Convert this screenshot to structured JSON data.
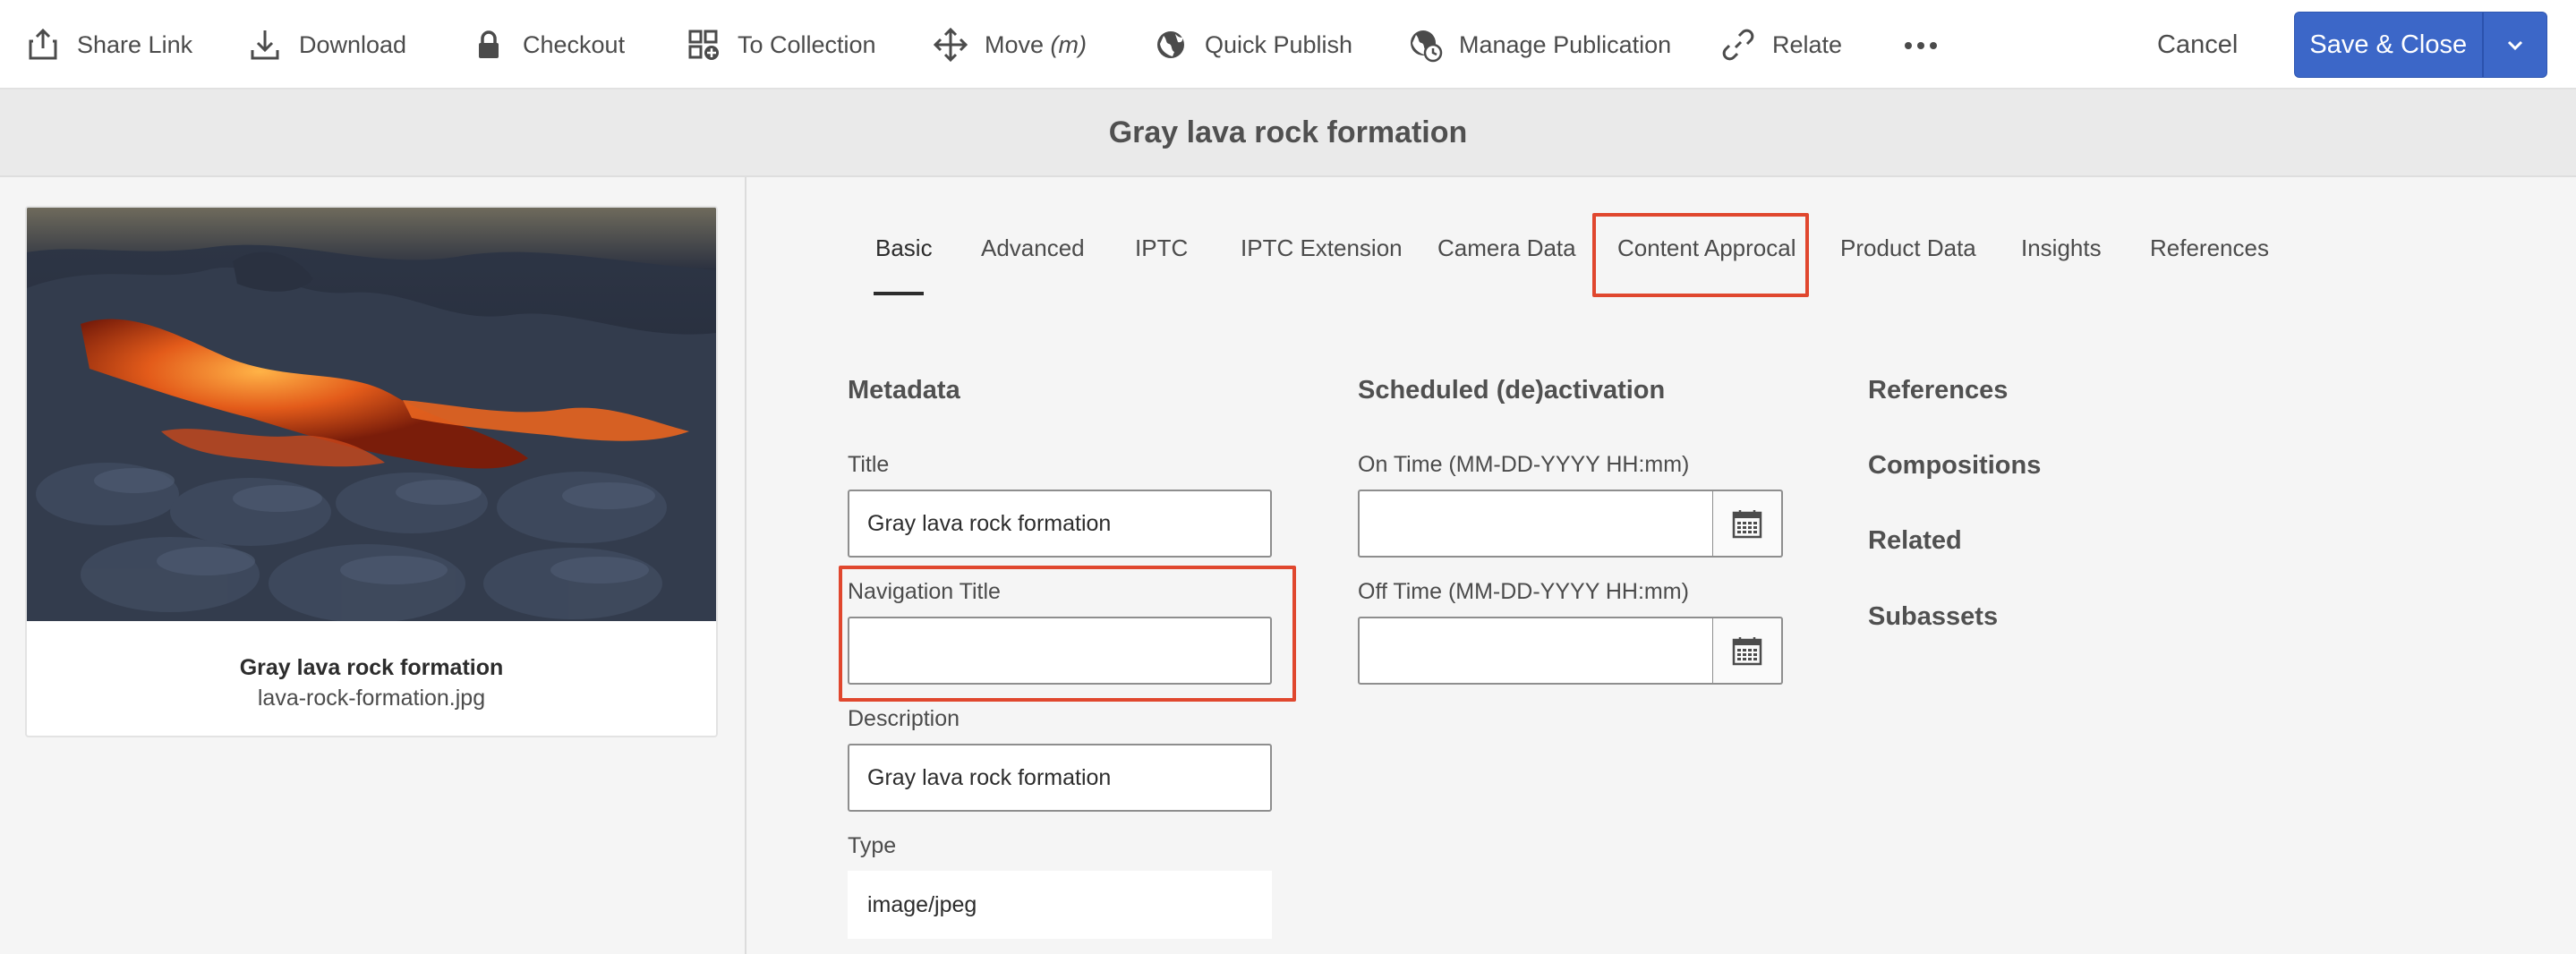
{
  "toolbar": {
    "share_link": "Share Link",
    "download": "Download",
    "checkout": "Checkout",
    "to_collection": "To Collection",
    "move": "Move",
    "move_shortcut": "(m)",
    "quick_publish": "Quick Publish",
    "manage_publication": "Manage Publication",
    "relate": "Relate",
    "cancel": "Cancel",
    "save_close": "Save & Close"
  },
  "page_title": "Gray lava rock formation",
  "asset": {
    "name": "Gray lava rock formation",
    "filename": "lava-rock-formation.jpg"
  },
  "tabs": [
    {
      "label": "Basic"
    },
    {
      "label": "Advanced"
    },
    {
      "label": "IPTC"
    },
    {
      "label": "IPTC Extension"
    },
    {
      "label": "Camera Data"
    },
    {
      "label": "Content Approcal"
    },
    {
      "label": "Product Data"
    },
    {
      "label": "Insights"
    },
    {
      "label": "References"
    }
  ],
  "metadata": {
    "heading": "Metadata",
    "title_label": "Title",
    "title_value": "Gray lava rock formation",
    "nav_title_label": "Navigation Title",
    "nav_title_value": "",
    "description_label": "Description",
    "description_value": "Gray lava rock formation",
    "type_label": "Type",
    "type_value": "image/jpeg"
  },
  "scheduled": {
    "heading": "Scheduled (de)activation",
    "on_time_label": "On Time (MM-DD-YYYY HH:mm)",
    "on_time_value": "",
    "off_time_label": "Off Time (MM-DD-YYYY HH:mm)",
    "off_time_value": ""
  },
  "side_links": {
    "references": "References",
    "compositions": "Compositions",
    "related": "Related",
    "subassets": "Subassets"
  },
  "colors": {
    "accent": "#3c67c8",
    "highlight": "#e0472e"
  }
}
